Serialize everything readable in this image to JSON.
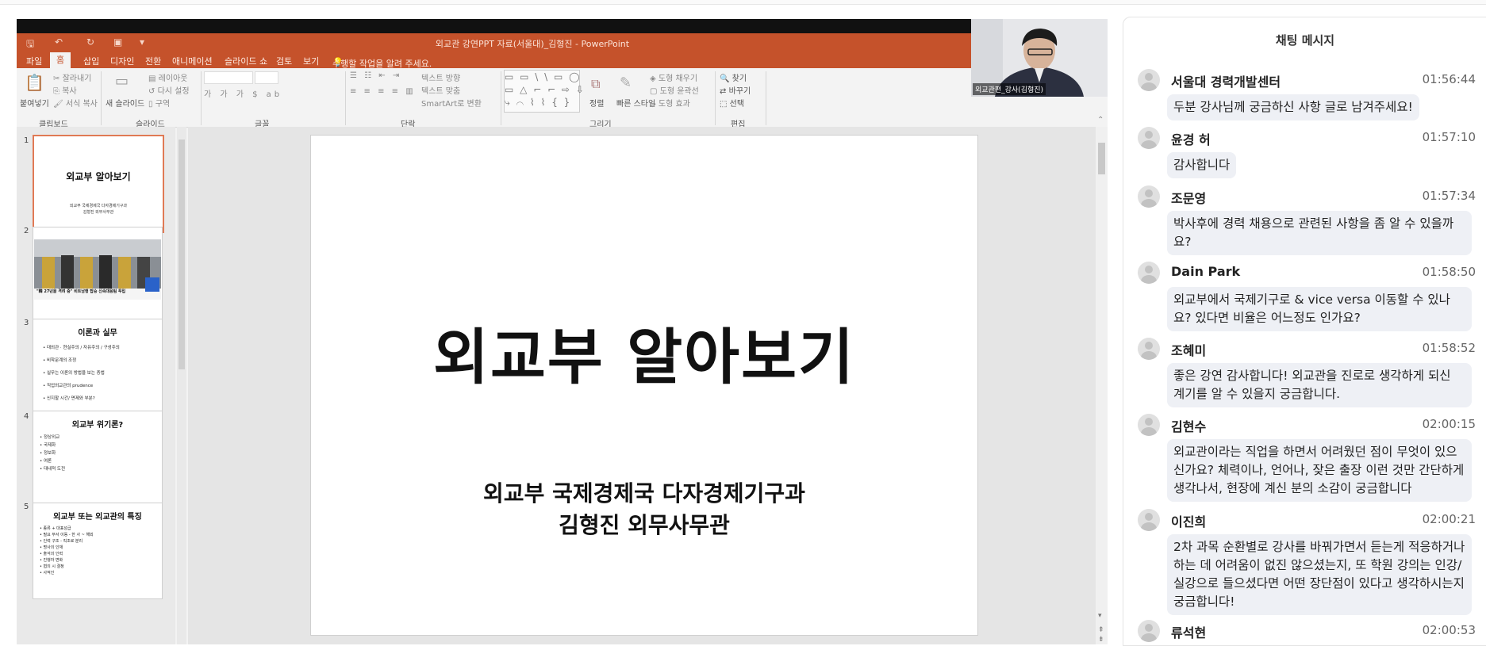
{
  "powerpoint": {
    "window_title": "외교관 강연PPT 자료(서울대)_김형진 - PowerPoint",
    "menu": {
      "file": "파일",
      "home": "홈",
      "insert": "삽입",
      "design": "디자인",
      "transitions": "전환",
      "animations": "애니메이션",
      "slideshow": "슬라이드 쇼",
      "review": "검토",
      "view": "보기",
      "tell_me": "수행할 작업을 알려 주세요."
    },
    "ribbon": {
      "paste": "붙여넣기",
      "cut": "잘라내기",
      "copy": "복사",
      "format_painter": "서식 복사",
      "new_slide": "새 슬라이드",
      "layout": "레이아웃",
      "reset": "다시 설정",
      "section": "구역",
      "text_direction": "텍스트 방향",
      "align_text": "텍스트 맞춤",
      "smartart": "SmartArt로 변환",
      "arrange": "정렬",
      "quick_styles": "빠른 스타일",
      "shape_fill": "도형 채우기",
      "shape_outline": "도형 윤곽선",
      "shape_effects": "도형 효과",
      "find": "찾기",
      "replace": "바꾸기",
      "select": "선택",
      "groups": {
        "clipboard": "클립보드",
        "slides": "슬라이드",
        "font": "글꼴",
        "paragraph": "단락",
        "drawing": "그리기",
        "editing": "편집"
      }
    },
    "thumbnails": [
      {
        "num": "1",
        "title": "외교부 알아보기",
        "lines": [
          "외교부 국제경제국 다자경제기구과",
          "김형진 외무사무관"
        ]
      },
      {
        "num": "2",
        "caption": "\"韓 27년을 격려 중\" 비트남행 탑승 신속대응팀 투입"
      },
      {
        "num": "3",
        "title": "이론과 실무",
        "lines": [
          "• 대외관 · 현실주의 / 자유주의 / 구성주의",
          "• 비학문계의 조정",
          "• 실무는 이론의 방법을 보는 증법",
          "• 직업외교관의 prudence",
          "• 신지할 시간/ 면제와 부분?"
        ],
        "highlight": "prudence"
      },
      {
        "num": "4",
        "title": "외교부 위기론?",
        "lines": [
          "• 정상외교",
          "• 국제화",
          "• 정보화",
          "• 여론",
          "• 대내적 도전"
        ]
      },
      {
        "num": "5",
        "title": "외교부 또는 외교관의 특징",
        "lines": [
          "• 종류 + 대표성급",
          "• 필요 부서 이동 - 한 사 ~ 해외",
          "• 인력 구조 - 직조로 분리",
          "• 명사의 인재",
          "• 출석의 인력",
          "• 진행자 변화",
          "• 협의 시 결정",
          "• 사적인"
        ]
      }
    ],
    "slide": {
      "title": "외교부 알아보기",
      "subtitle_line1": "외교부 국제경제국 다자경제기구과",
      "subtitle_line2": "김형진 외무사무관"
    },
    "video_label": "외교관편_강사(김형진)"
  },
  "chat": {
    "title": "채팅 메시지",
    "messages": [
      {
        "sender": "서울대 경력개발센터",
        "time": "01:56:44",
        "text": "두분 강사님께 궁금하신 사항 글로 남겨주세요!"
      },
      {
        "sender": "윤경 허",
        "time": "01:57:10",
        "text": "감사합니다"
      },
      {
        "sender": "조문영",
        "time": "01:57:34",
        "text": "박사후에 경력 채용으로 관련된 사항을 좀 알 수 있을까요?"
      },
      {
        "sender": "Dain Park",
        "time": "01:58:50",
        "text": "외교부에서 국제기구로 & vice versa 이동할 수 있나요? 있다면 비율은 어느정도 인가요?"
      },
      {
        "sender": "조혜미",
        "time": "01:58:52",
        "text": "좋은 강연 감사합니다! 외교관을 진로로 생각하게 되신 계기를 알 수 있을지 궁금합니다."
      },
      {
        "sender": "김현수",
        "time": "02:00:15",
        "text": "외교관이라는 직업을 하면서 어려웠던 점이 무엇이 있으신가요? 체력이나, 언어나, 잦은 출장 이런 것만 간단하게 생각나서, 현장에 계신 분의 소감이 궁금합니다"
      },
      {
        "sender": "이진희",
        "time": "02:00:21",
        "text": "2차 과목 순환별로 강사를 바꿔가면서 듣는게 적응하거나 하는 데 어려움이 없진 않으셨는지, 또 학원 강의는 인강/실강으로 들으셨다면 어떤 장단점이 있다고 생각하시는지 궁금합니다!"
      },
      {
        "sender": "류석현",
        "time": "02:00:53",
        "text": ""
      }
    ]
  }
}
